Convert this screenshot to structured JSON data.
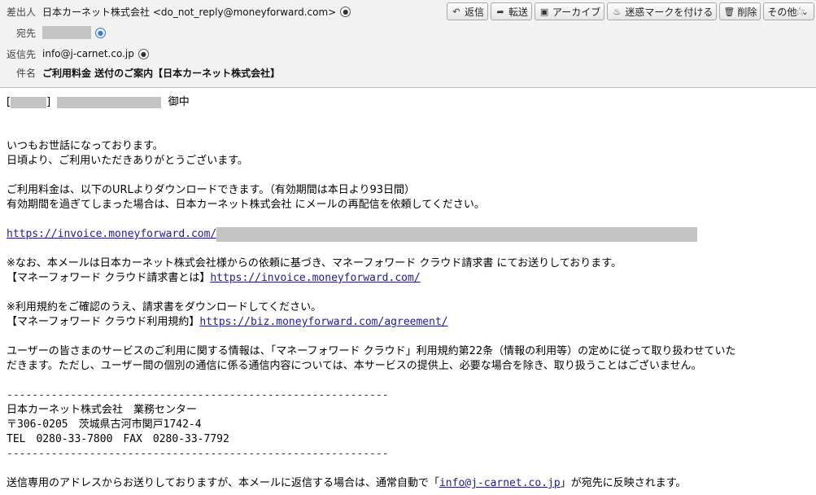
{
  "header": {
    "from_label": "差出人",
    "from_value": "日本カーネット株式会社 <do_not_reply@moneyforward.com>",
    "to_label": "宛先",
    "replyto_label": "返信先",
    "replyto_value": "info@j-carnet.co.jp",
    "subject_label": "件名",
    "subject_value": "ご利用料金 送付のご案内【日本カーネット株式会社】"
  },
  "toolbar": {
    "reply": "返信",
    "forward": "転送",
    "archive": "アーカイブ",
    "junk": "迷惑マークを付ける",
    "delete": "削除",
    "other": "その他"
  },
  "body": {
    "salutation_open": "[",
    "salutation_close": "]",
    "salutation_suffix": "御中",
    "p1_l1": "いつもお世話になっております。",
    "p1_l2": "日頃より、ご利用いただきありがとうございます。",
    "p2_l1": "ご利用料金は、以下のURLよりダウンロードできます。（有効期間は本日より93日間）",
    "p2_l2": "有効期間を過ぎてしまった場合は、日本カーネット株式会社 にメールの再配信を依頼してください。",
    "invoice_link": "https://invoice.moneyforward.com/",
    "p3_l1": "※なお、本メールは日本カーネット株式会社様からの依頼に基づき、マネーフォワード クラウド請求書 にてお送りしております。",
    "p3_l2_prefix": "【マネーフォワード クラウド請求書とは】",
    "p3_link": "https://invoice.moneyforward.com/",
    "p4_l1": "※利用規約をご確認のうえ、請求書をダウンロードしてください。",
    "p4_l2_prefix": "【マネーフォワード クラウド利用規約】",
    "p4_link": "https://biz.moneyforward.com/agreement/",
    "p5_l1": "ユーザーの皆さまのサービスのご利用に関する情報は、「マネーフォワード クラウド」利用規約第22条（情報の利用等）の定めに従って取り扱わせていた",
    "p5_l2": "だきます。ただし、ユーザー間の個別の通信に係る通信内容については、本サービスの提供上、必要な場合を除き、取り扱うことはございません。",
    "divider": "------------------------------------------------------------",
    "sig_l1": "日本カーネット株式会社　業務センター",
    "sig_l2": "〒306-0205　茨城県古河市関戸1742-4",
    "sig_l3": "TEL　0280-33-7800　FAX　0280-33-7792",
    "footer_prefix": "送信専用のアドレスからお送りしておりますが、本メールに返信する場合は、通常自動で「",
    "footer_link": "info@j-carnet.co.jp",
    "footer_suffix": "」が宛先に反映されます。"
  }
}
